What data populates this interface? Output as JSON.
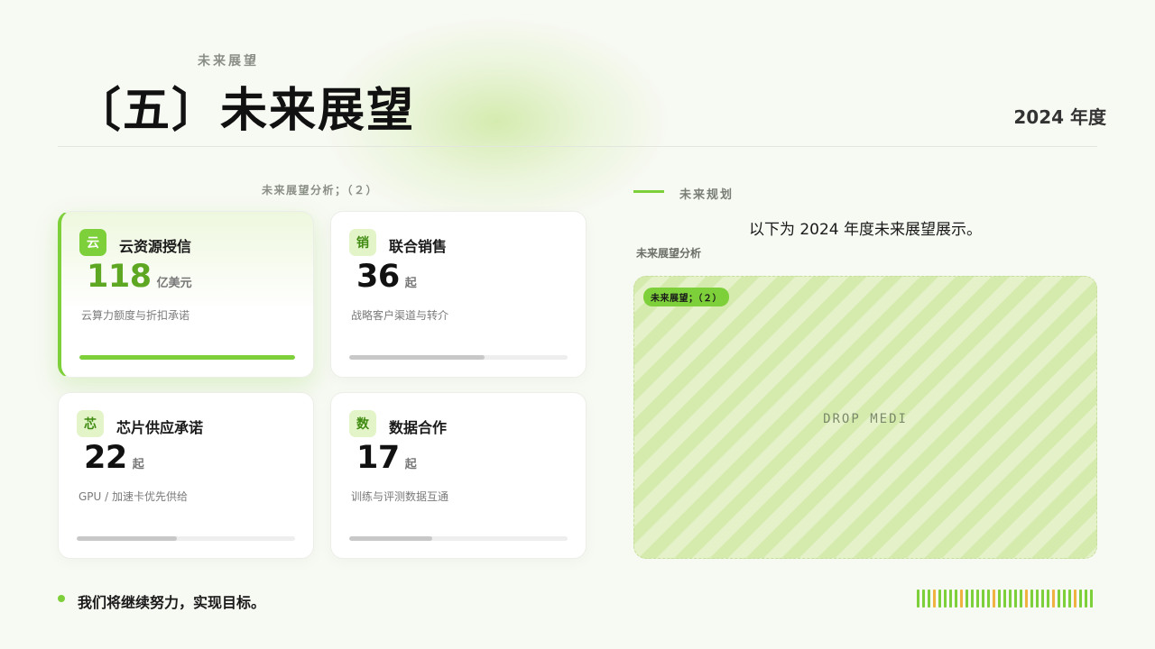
{
  "header": {
    "kicker": "未来展望",
    "title": "〔五〕未来展望",
    "year": "2024 年度"
  },
  "left_panel": {
    "label": "未来展望分析；（２）",
    "cards": [
      {
        "badge": "云",
        "title": "云资源授信",
        "value": "118",
        "unit": "亿美元",
        "desc": "云算力额度与折扣承诺",
        "progress": 1.0,
        "active": true
      },
      {
        "badge": "销",
        "title": "联合销售",
        "value": "36",
        "unit": "起",
        "desc": "战略客户渠道与转介",
        "progress": 0.62,
        "active": false
      },
      {
        "badge": "芯",
        "title": "芯片供应承诺",
        "value": "22",
        "unit": "起",
        "desc": "GPU /  加速卡优先供给",
        "progress": 0.46,
        "active": false
      },
      {
        "badge": "数",
        "title": "数据合作",
        "value": "17",
        "unit": "起",
        "desc": "训练与评测数据互通",
        "progress": 0.38,
        "active": false
      }
    ]
  },
  "right_panel": {
    "label": "未来规划",
    "subtitle": "以下为 2024 年度未来展望展示。",
    "section": "未来展望分析",
    "media_chip": "未来展望；（２）",
    "media_text": "DROP MEDI"
  },
  "footer": {
    "text": "我们将继续努力，实现目标。"
  },
  "colors": {
    "accent": "#7ed03a",
    "accent_dark": "#5ea722",
    "tick_pattern": [
      "#7ed03a",
      "#7ed03a",
      "#7ed03a",
      "#f0b341",
      "#7ed03a",
      "#7ed03a",
      "#7ed03a",
      "#7ed03a",
      "#f0b341",
      "#7ed03a",
      "#7ed03a",
      "#7ed03a",
      "#7ed03a",
      "#7ed03a",
      "#f0b341",
      "#7ed03a",
      "#7ed03a",
      "#7ed03a",
      "#7ed03a",
      "#7ed03a",
      "#f0b341",
      "#7ed03a",
      "#7ed03a",
      "#7ed03a",
      "#7ed03a",
      "#f0b341",
      "#7ed03a",
      "#7ed03a",
      "#7ed03a",
      "#f0b341",
      "#7ed03a",
      "#7ed03a",
      "#7ed03a"
    ]
  }
}
